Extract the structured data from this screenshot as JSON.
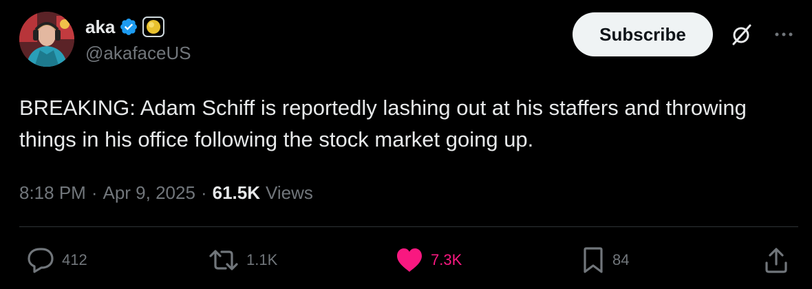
{
  "author": {
    "display_name": "aka",
    "handle": "@akafaceUS",
    "verified": true,
    "verified_icon": "verified-badge-icon",
    "affiliate_badge_icon": "yellow-circle-badge-icon"
  },
  "header": {
    "subscribe_label": "Subscribe",
    "grok_icon": "grok-icon",
    "more_icon": "more-horizontal-icon"
  },
  "tweet": {
    "text": "BREAKING: Adam Schiff is reportedly lashing out at his staffers and throwing things in his office following the stock market going up.",
    "time": "8:18 PM",
    "date": "Apr 9, 2025",
    "views_count": "61.5K",
    "views_label": "Views"
  },
  "actions": {
    "reply": {
      "icon": "reply-icon",
      "count": "412"
    },
    "repost": {
      "icon": "repost-icon",
      "count": "1.1K"
    },
    "like": {
      "icon": "heart-icon",
      "count": "7.3K",
      "liked": true,
      "color": "#f91880"
    },
    "bookmark": {
      "icon": "bookmark-icon",
      "count": "84"
    },
    "share": {
      "icon": "share-icon"
    }
  },
  "colors": {
    "background": "#000000",
    "text_primary": "#e7e9ea",
    "text_secondary": "#71767b",
    "verified_blue": "#1d9bf0",
    "like_pink": "#f91880",
    "divider": "#2f3336",
    "button_bg": "#eff3f4"
  }
}
